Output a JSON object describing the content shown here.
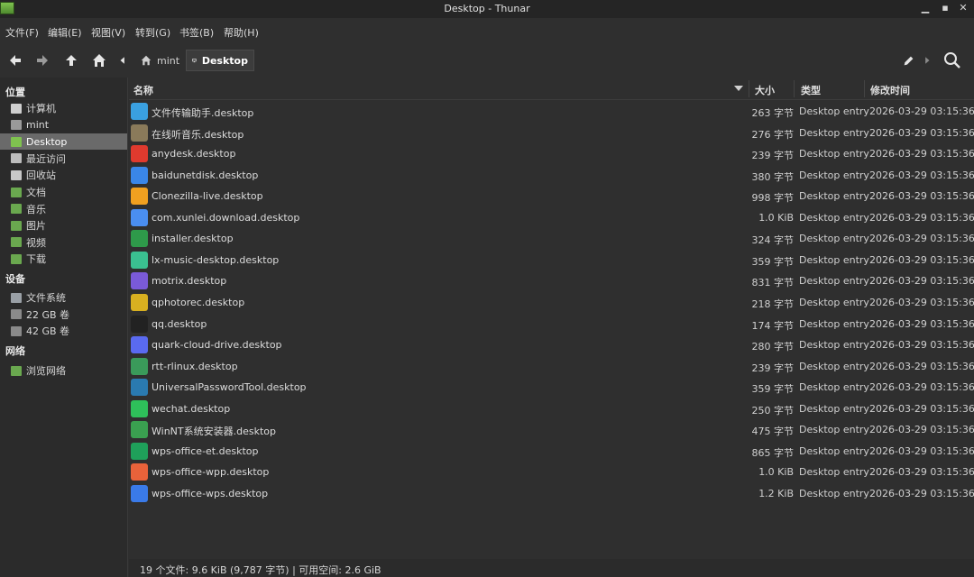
{
  "window": {
    "title": "Desktop - Thunar"
  },
  "menu": [
    "文件(F)",
    "编辑(E)",
    "视图(V)",
    "转到(G)",
    "书签(B)",
    "帮助(H)"
  ],
  "path": {
    "parent": "mint",
    "current": "Desktop"
  },
  "sidebar": {
    "places_label": "位置",
    "places": [
      {
        "label": "计算机",
        "icon": "computer-icon"
      },
      {
        "label": "mint",
        "icon": "home-folder-icon"
      },
      {
        "label": "Desktop",
        "icon": "desktop-icon",
        "active": true
      },
      {
        "label": "最近访问",
        "icon": "recent-icon"
      },
      {
        "label": "回收站",
        "icon": "trash-icon"
      },
      {
        "label": "文档",
        "icon": "documents-folder-icon"
      },
      {
        "label": "音乐",
        "icon": "music-folder-icon"
      },
      {
        "label": "图片",
        "icon": "pictures-folder-icon"
      },
      {
        "label": "视频",
        "icon": "videos-folder-icon"
      },
      {
        "label": "下载",
        "icon": "downloads-folder-icon"
      }
    ],
    "devices_label": "设备",
    "devices": [
      {
        "label": "文件系统",
        "icon": "filesystem-icon"
      },
      {
        "label": "22 GB 卷",
        "icon": "drive-icon"
      },
      {
        "label": "42 GB 卷",
        "icon": "drive-icon"
      }
    ],
    "network_label": "网络",
    "network": [
      {
        "label": "浏览网络",
        "icon": "network-icon"
      }
    ]
  },
  "columns": {
    "name": "名称",
    "size": "大小",
    "type": "类型",
    "modified": "修改时间"
  },
  "files": [
    {
      "name": "文件传输助手.desktop",
      "size": "263 字节",
      "type": "Desktop entry",
      "modified": "2026-03-29 03:15:36",
      "color": "#3aa0e0"
    },
    {
      "name": "在线听音乐.desktop",
      "size": "276 字节",
      "type": "Desktop entry",
      "modified": "2026-03-29 03:15:36",
      "color": "#8a7a5a"
    },
    {
      "name": "anydesk.desktop",
      "size": "239 字节",
      "type": "Desktop entry",
      "modified": "2026-03-29 03:15:36",
      "color": "#e03a2e"
    },
    {
      "name": "baidunetdisk.desktop",
      "size": "380 字节",
      "type": "Desktop entry",
      "modified": "2026-03-29 03:15:36",
      "color": "#3a86e8"
    },
    {
      "name": "Clonezilla-live.desktop",
      "size": "998 字节",
      "type": "Desktop entry",
      "modified": "2026-03-29 03:15:36",
      "color": "#f0a020"
    },
    {
      "name": "com.xunlei.download.desktop",
      "size": "1.0 KiB",
      "type": "Desktop entry",
      "modified": "2026-03-29 03:15:36",
      "color": "#4a8ef0"
    },
    {
      "name": "installer.desktop",
      "size": "324 字节",
      "type": "Desktop entry",
      "modified": "2026-03-29 03:15:36",
      "color": "#2e9a4a"
    },
    {
      "name": "lx-music-desktop.desktop",
      "size": "359 字节",
      "type": "Desktop entry",
      "modified": "2026-03-29 03:15:36",
      "color": "#3ac090"
    },
    {
      "name": "motrix.desktop",
      "size": "831 字节",
      "type": "Desktop entry",
      "modified": "2026-03-29 03:15:36",
      "color": "#7a5ad8"
    },
    {
      "name": "qphotorec.desktop",
      "size": "218 字节",
      "type": "Desktop entry",
      "modified": "2026-03-29 03:15:36",
      "color": "#d8b020"
    },
    {
      "name": "qq.desktop",
      "size": "174 字节",
      "type": "Desktop entry",
      "modified": "2026-03-29 03:15:36",
      "color": "#222222"
    },
    {
      "name": "quark-cloud-drive.desktop",
      "size": "280 字节",
      "type": "Desktop entry",
      "modified": "2026-03-29 03:15:36",
      "color": "#5a6af0"
    },
    {
      "name": "rtt-rlinux.desktop",
      "size": "239 字节",
      "type": "Desktop entry",
      "modified": "2026-03-29 03:15:36",
      "color": "#3a9a5a"
    },
    {
      "name": "UniversalPasswordTool.desktop",
      "size": "359 字节",
      "type": "Desktop entry",
      "modified": "2026-03-29 03:15:36",
      "color": "#2a7ab0"
    },
    {
      "name": "wechat.desktop",
      "size": "250 字节",
      "type": "Desktop entry",
      "modified": "2026-03-29 03:15:36",
      "color": "#2ec05a"
    },
    {
      "name": "WinNT系统安装器.desktop",
      "size": "475 字节",
      "type": "Desktop entry",
      "modified": "2026-03-29 03:15:36",
      "color": "#3aa050"
    },
    {
      "name": "wps-office-et.desktop",
      "size": "865 字节",
      "type": "Desktop entry",
      "modified": "2026-03-29 03:15:36",
      "color": "#1fa05a"
    },
    {
      "name": "wps-office-wpp.desktop",
      "size": "1.0 KiB",
      "type": "Desktop entry",
      "modified": "2026-03-29 03:15:36",
      "color": "#e8623a"
    },
    {
      "name": "wps-office-wps.desktop",
      "size": "1.2 KiB",
      "type": "Desktop entry",
      "modified": "2026-03-29 03:15:36",
      "color": "#3a7ae8"
    }
  ],
  "status": "19 个文件: 9.6 KiB (9,787 字节) | 可用空间: 2.6 GiB"
}
